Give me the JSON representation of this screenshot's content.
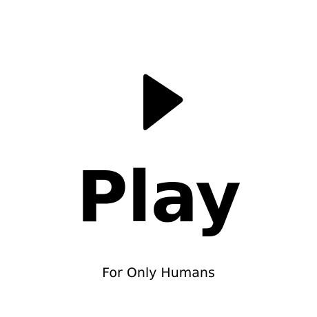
{
  "app": {
    "title": "Play",
    "tagline": "For Only Humans",
    "icon": "play-icon"
  },
  "colors": {
    "background": "#ffffff",
    "foreground": "#000000"
  }
}
